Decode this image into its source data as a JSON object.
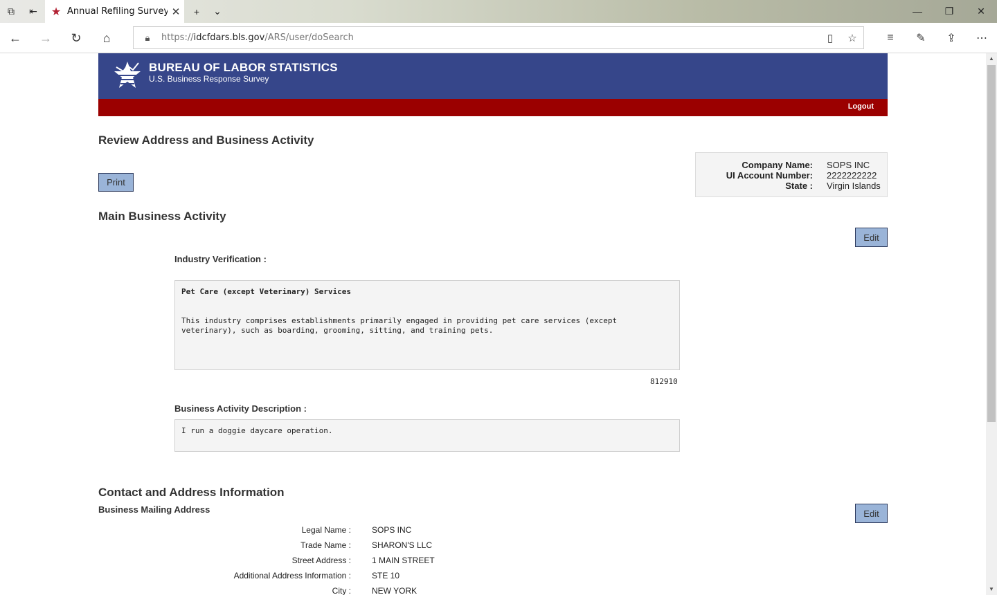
{
  "browser": {
    "tab_title": "Annual Refiling Survey -",
    "url_prefix": "https://",
    "url_host": "idcfdars.bls.gov",
    "url_path": "/ARS/user/doSearch"
  },
  "header": {
    "agency": "BUREAU OF LABOR STATISTICS",
    "subtitle": "U.S. Business Response Survey",
    "logout": "Logout",
    "brand_blue": "#36468a",
    "brand_red": "#9b0000"
  },
  "page": {
    "title": "Review Address and Business Activity",
    "print_label": "Print"
  },
  "company": {
    "name_label": "Company Name:",
    "name": "SOPS INC",
    "account_label": "UI Account Number:",
    "account": "2222222222",
    "state_label": "State :",
    "state": "Virgin Islands"
  },
  "activity": {
    "heading": "Main Business Activity",
    "edit_label": "Edit",
    "industry_label": "Industry Verification :",
    "industry_title": "Pet Care (except Veterinary) Services",
    "industry_desc_line1": "This industry comprises establishments primarily engaged in providing pet care services (except",
    "industry_desc_line2": "veterinary), such as boarding, grooming, sitting, and training pets.",
    "naics_code": "812910",
    "desc_label": "Business Activity Description :",
    "desc_value": "I run a doggie daycare operation."
  },
  "contact": {
    "heading": "Contact and Address Information",
    "mailing_heading": "Business Mailing Address",
    "edit_label": "Edit",
    "rows": [
      {
        "label": "Legal Name :",
        "value": "SOPS INC"
      },
      {
        "label": "Trade Name :",
        "value": "SHARON'S LLC"
      },
      {
        "label": "Street Address :",
        "value": "1 MAIN STREET"
      },
      {
        "label": "Additional Address Information :",
        "value": "STE 10"
      },
      {
        "label": "City :",
        "value": "NEW YORK"
      }
    ]
  }
}
